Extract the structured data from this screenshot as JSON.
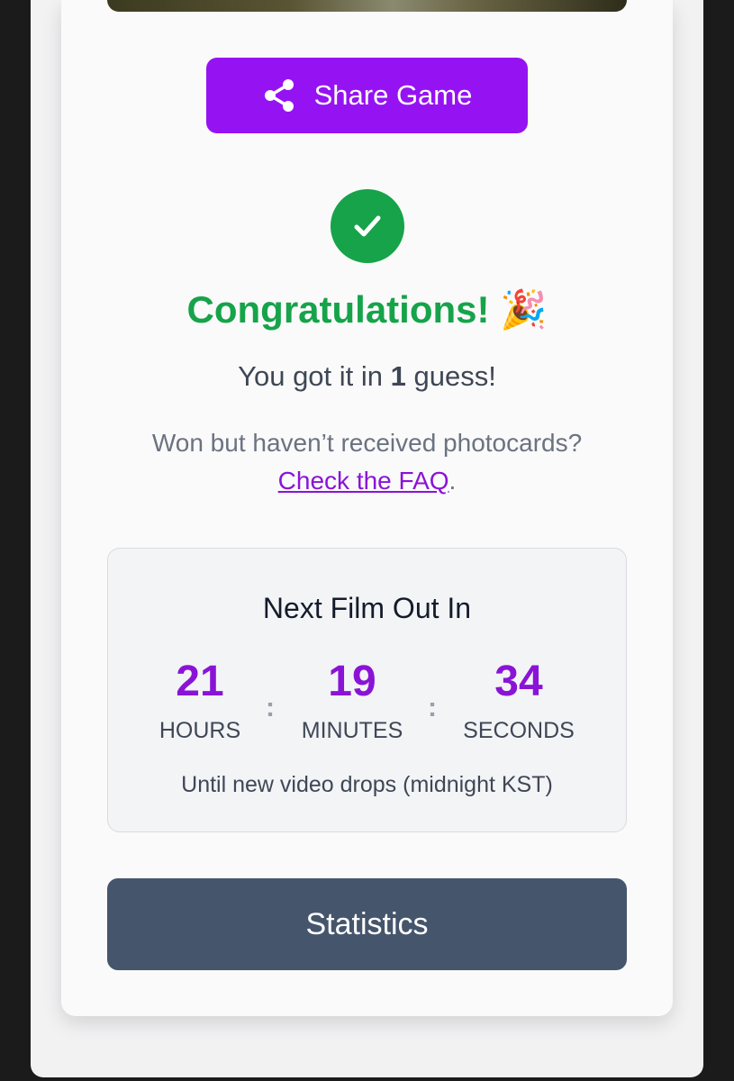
{
  "share": {
    "label": "Share Game",
    "icon": "share-icon"
  },
  "result": {
    "title": "Congratulations!",
    "emoji": "🎉",
    "guess_prefix": "You got it in ",
    "guess_count": "1",
    "guess_suffix": " guess!",
    "won_text": "Won but haven’t received photocards?",
    "faq_link": "Check the FAQ",
    "faq_period": "."
  },
  "countdown": {
    "title": "Next Film Out In",
    "hours": "21",
    "hours_label": "HOURS",
    "minutes": "19",
    "minutes_label": "MINUTES",
    "seconds": "34",
    "seconds_label": "SECONDS",
    "separator": ":",
    "note": "Until new video drops (midnight KST)"
  },
  "statistics": {
    "label": "Statistics"
  },
  "colors": {
    "accent_purple": "#9513f2",
    "success_green": "#16a34a",
    "stats_slate": "#45556c"
  }
}
